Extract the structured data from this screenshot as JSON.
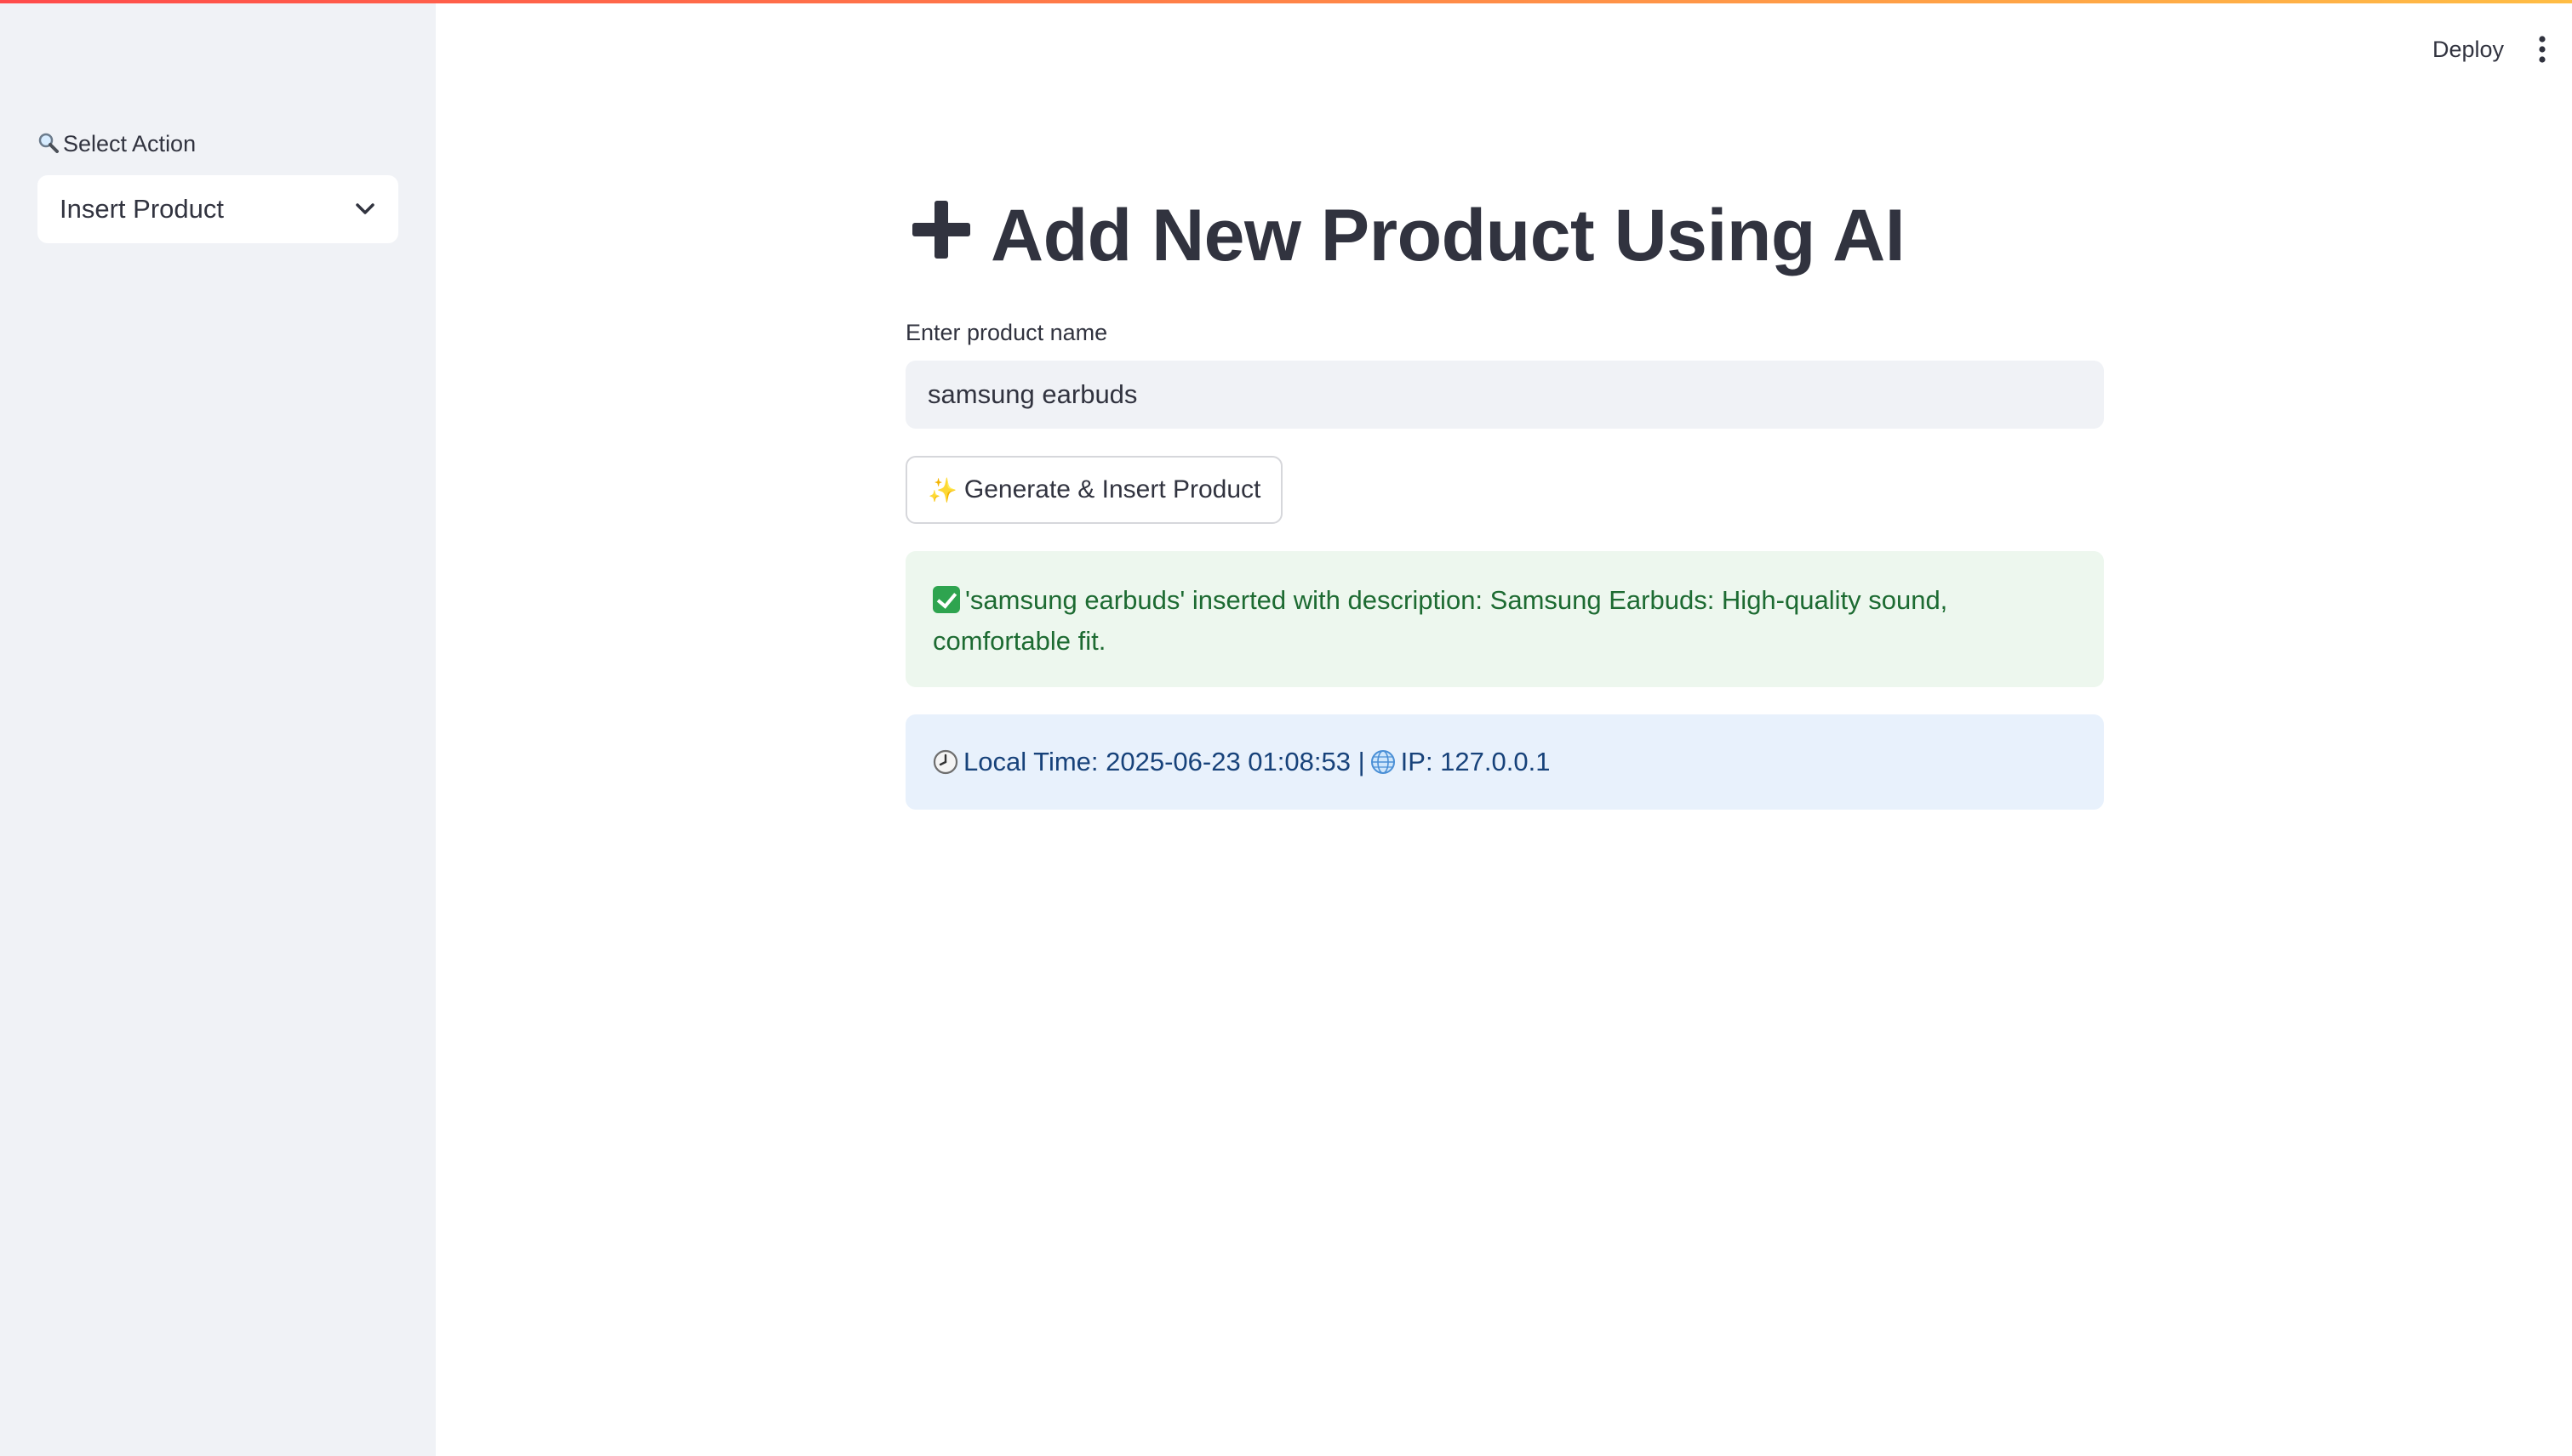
{
  "sidebar": {
    "label": "Select Action",
    "label_icon": "magnifier-icon",
    "select": {
      "value": "Insert Product",
      "chevron": "chevron-down-icon"
    }
  },
  "header": {
    "deploy_label": "Deploy",
    "menu_icon": "vertical-dots-icon"
  },
  "main": {
    "title": "Add New Product Using AI",
    "title_icon": "plus-icon",
    "input": {
      "label": "Enter product name",
      "value": "samsung earbuds"
    },
    "button": {
      "label": "Generate & Insert Product",
      "icon": "sparkles-icon"
    },
    "success": {
      "icon": "check-box-icon",
      "text": "'samsung earbuds' inserted with description: Samsung Earbuds: High-quality sound, comfortable fit."
    },
    "info": {
      "clock_icon": "clock-icon",
      "time_text": "Local Time: 2025-06-23 01:08:53 |",
      "globe_icon": "globe-icon",
      "ip_text": "IP: 127.0.0.1"
    }
  },
  "colors": {
    "accent_start": "#ff4b4b",
    "accent_end": "#ffbd45",
    "success_bg": "#edf7ee",
    "success_text": "#1d6b32",
    "info_bg": "#e8f1fc",
    "info_text": "#17427a"
  }
}
